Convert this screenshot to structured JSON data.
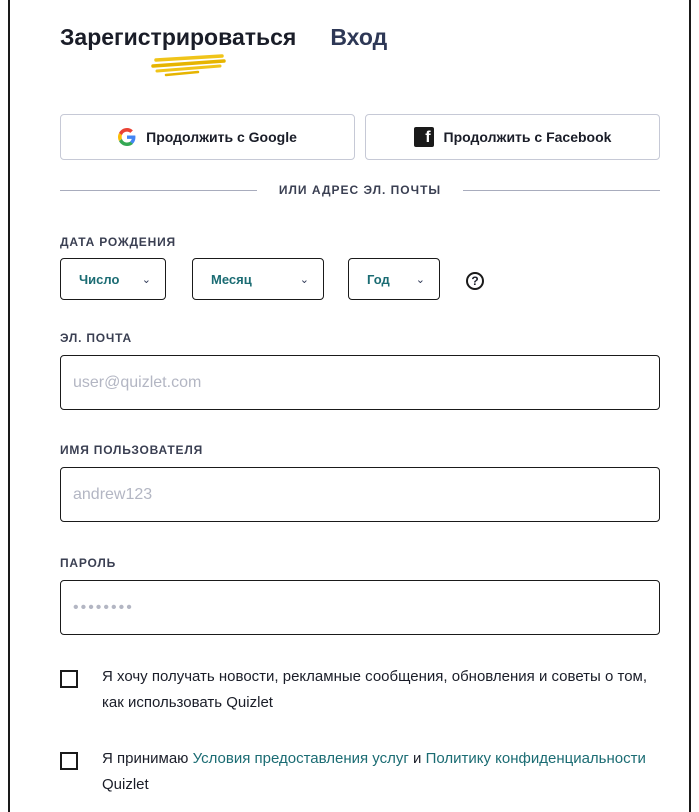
{
  "tabs": {
    "signup": "Зарегистрироваться",
    "login": "Вход"
  },
  "social": {
    "google_label": "Продолжить с Google",
    "facebook_label": "Продолжить с Facebook"
  },
  "divider_text": "ИЛИ АДРЕС ЭЛ. ПОЧТЫ",
  "birthdate": {
    "label": "ДАТА РОЖДЕНИЯ",
    "day": "Число",
    "month": "Месяц",
    "year": "Год",
    "help_glyph": "?"
  },
  "email": {
    "label": "ЭЛ. ПОЧТА",
    "placeholder": "user@quizlet.com"
  },
  "username": {
    "label": "ИМЯ ПОЛЬЗОВАТЕЛЯ",
    "placeholder": "andrew123"
  },
  "password": {
    "label": "ПАРОЛЬ",
    "placeholder": "••••••••"
  },
  "newsletter": {
    "text": "Я хочу получать новости, рекламные сообщения, обновления и советы о том, как использовать Quizlet"
  },
  "terms": {
    "prefix": "Я принимаю ",
    "terms_link": "Условия предоставления услуг",
    "and": " и ",
    "privacy_link": "Политику конфиденциальности",
    "suffix": " Quizlet"
  },
  "colors": {
    "accent_teal": "#1b6c73",
    "highlight_yellow": "#f0c419"
  }
}
